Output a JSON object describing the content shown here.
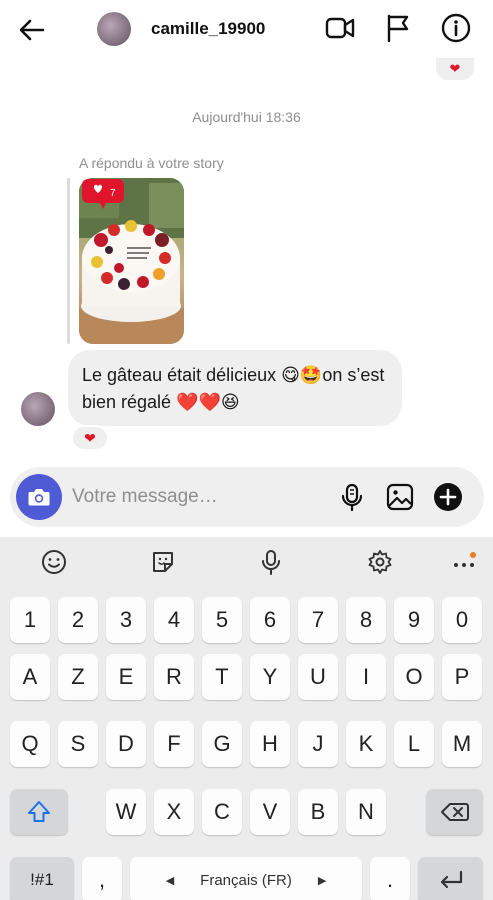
{
  "header": {
    "username": "camille_19900",
    "icons": [
      "back-arrow-icon",
      "video-call-icon",
      "flag-icon",
      "info-icon"
    ]
  },
  "conversation": {
    "timestamp": "Aujourd'hui 18:36",
    "story_reply_label": "A répondu à votre story",
    "story_like_count": "7",
    "message_text": "Le gâteau était délicieux 😋🤩on s’est bien régalé ❤️❤️😆",
    "reaction_top": "❤",
    "reaction_message": "❤"
  },
  "composer": {
    "placeholder": "Votre message…",
    "icons": [
      "camera-icon",
      "microphone-icon",
      "gallery-icon",
      "plus-icon"
    ]
  },
  "keyboard": {
    "row_numbers": [
      "1",
      "2",
      "3",
      "4",
      "5",
      "6",
      "7",
      "8",
      "9",
      "0"
    ],
    "row_1": [
      "A",
      "Z",
      "E",
      "R",
      "T",
      "Y",
      "U",
      "I",
      "O",
      "P"
    ],
    "row_2": [
      "Q",
      "S",
      "D",
      "F",
      "G",
      "H",
      "J",
      "K",
      "L",
      "M"
    ],
    "row_3": [
      "W",
      "X",
      "C",
      "V",
      "B",
      "N"
    ],
    "symbols_key": "!#1",
    "comma_key": ",",
    "space_label": "Français (FR)",
    "period_key": ".",
    "toolbar_icons": [
      "emoji-icon",
      "sticker-icon",
      "microphone-icon",
      "settings-icon",
      "more-icon"
    ]
  },
  "colors": {
    "accent": "#4f5bd5",
    "heart": "#e0152b",
    "bubble": "#efefef",
    "keyboard_bg": "#ececec",
    "shift_active": "#1a73e8"
  }
}
